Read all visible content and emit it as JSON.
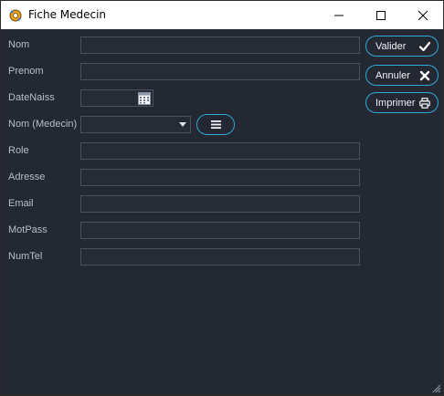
{
  "window": {
    "title": "Fiche Medecin"
  },
  "form": {
    "labels": {
      "nom": "Nom",
      "prenom": "Prenom",
      "date_naiss": "DateNaiss",
      "nom_medecin": "Nom (Medecin)",
      "role": "Role",
      "adresse": "Adresse",
      "email": "Email",
      "mot_pass": "MotPass",
      "num_tel": "NumTel"
    },
    "values": {
      "nom": "",
      "prenom": "",
      "date_naiss": "",
      "nom_medecin": "",
      "role": "",
      "adresse": "",
      "email": "",
      "mot_pass": "",
      "num_tel": ""
    }
  },
  "actions": {
    "valider": "Valider",
    "annuler": "Annuler",
    "imprimer": "Imprimer"
  },
  "icons": {
    "app": "gear-app-icon",
    "valider": "check-icon",
    "annuler": "x-icon",
    "imprimer": "printer-icon",
    "calendar": "calendar-icon",
    "combo": "chevron-down-icon",
    "list": "list-icon"
  },
  "colors": {
    "background": "#232833",
    "accent": "#2ea8d8",
    "field_border": "#4a505c",
    "label": "#b9bec8"
  }
}
